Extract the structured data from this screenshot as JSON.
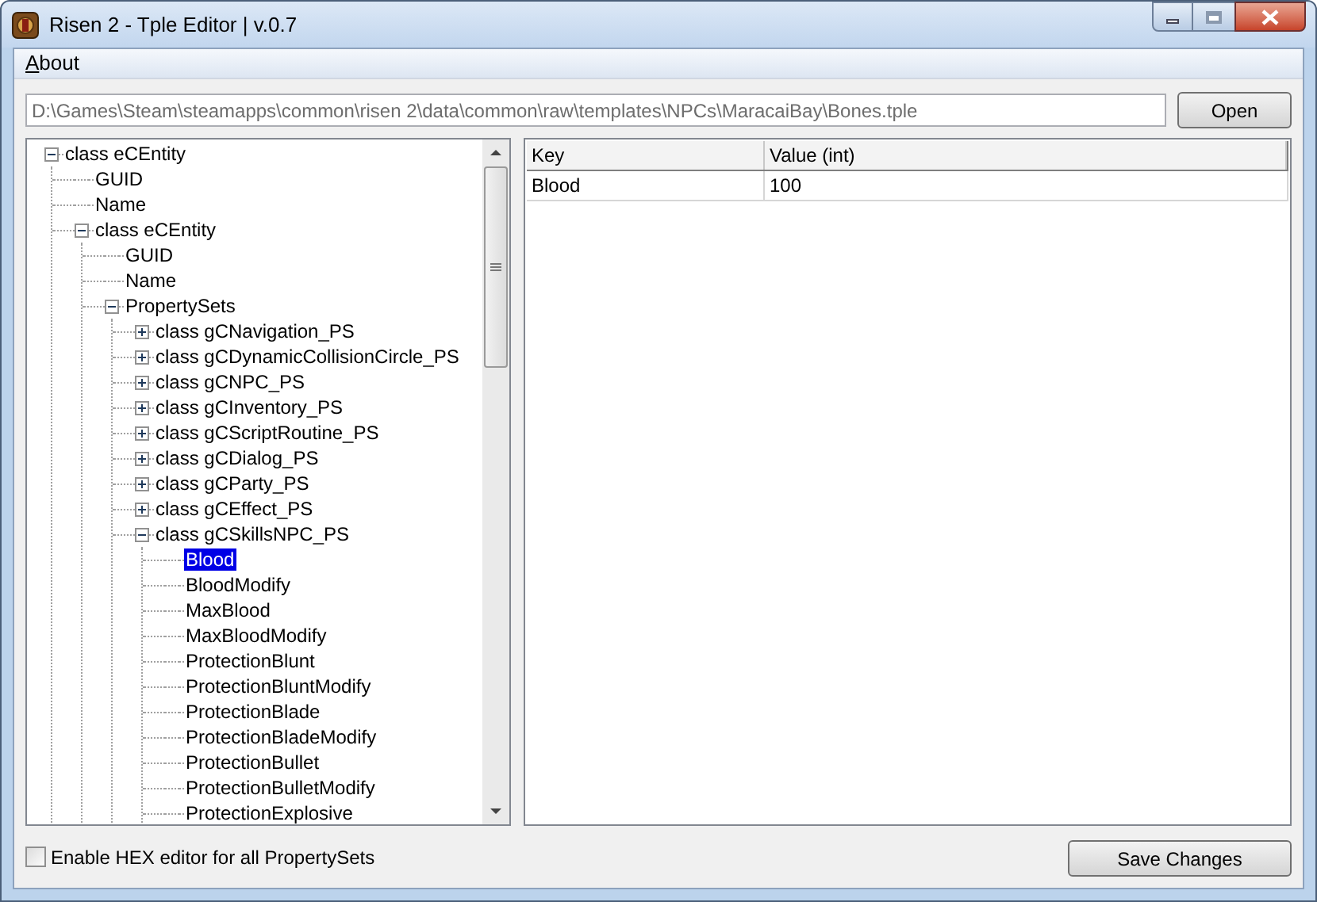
{
  "window": {
    "title": "Risen 2 - Tple Editor | v.0.7"
  },
  "menu": [
    {
      "label": "About"
    }
  ],
  "path_field": {
    "value": "D:\\Games\\Steam\\steamapps\\common\\risen 2\\data\\common\\raw\\templates\\NPCs\\MaracaiBay\\Bones.tple"
  },
  "open_button": "Open",
  "tree": [
    {
      "label": "class eCEntity",
      "expanded": true,
      "selected": false,
      "children": [
        {
          "label": "GUID",
          "selected": false
        },
        {
          "label": "Name",
          "selected": false
        },
        {
          "label": "class eCEntity",
          "expanded": true,
          "selected": false,
          "children": [
            {
              "label": "GUID",
              "selected": false
            },
            {
              "label": "Name",
              "selected": false
            },
            {
              "label": "PropertySets",
              "expanded": true,
              "selected": false,
              "children": [
                {
                  "label": "class gCNavigation_PS",
                  "expanded": false,
                  "selected": false
                },
                {
                  "label": "class gCDynamicCollisionCircle_PS",
                  "expanded": false,
                  "selected": false
                },
                {
                  "label": "class gCNPC_PS",
                  "expanded": false,
                  "selected": false
                },
                {
                  "label": "class gCInventory_PS",
                  "expanded": false,
                  "selected": false
                },
                {
                  "label": "class gCScriptRoutine_PS",
                  "expanded": false,
                  "selected": false
                },
                {
                  "label": "class gCDialog_PS",
                  "expanded": false,
                  "selected": false
                },
                {
                  "label": "class gCParty_PS",
                  "expanded": false,
                  "selected": false
                },
                {
                  "label": "class gCEffect_PS",
                  "expanded": false,
                  "selected": false
                },
                {
                  "label": "class gCSkillsNPC_PS",
                  "expanded": true,
                  "selected": false,
                  "children": [
                    {
                      "label": "Blood",
                      "selected": true
                    },
                    {
                      "label": "BloodModify",
                      "selected": false
                    },
                    {
                      "label": "MaxBlood",
                      "selected": false
                    },
                    {
                      "label": "MaxBloodModify",
                      "selected": false
                    },
                    {
                      "label": "ProtectionBlunt",
                      "selected": false
                    },
                    {
                      "label": "ProtectionBluntModify",
                      "selected": false
                    },
                    {
                      "label": "ProtectionBlade",
                      "selected": false
                    },
                    {
                      "label": "ProtectionBladeModify",
                      "selected": false
                    },
                    {
                      "label": "ProtectionBullet",
                      "selected": false
                    },
                    {
                      "label": "ProtectionBulletModify",
                      "selected": false
                    },
                    {
                      "label": "ProtectionExplosive",
                      "selected": false
                    }
                  ]
                }
              ]
            }
          ]
        }
      ]
    }
  ],
  "table": {
    "columns": [
      "Key",
      "Value (int)"
    ],
    "rows": [
      {
        "key": "Blood",
        "value": "100"
      }
    ]
  },
  "hex_checkbox": {
    "label": "Enable HEX editor for all PropertySets",
    "checked": false
  },
  "save_button": "Save Changes"
}
